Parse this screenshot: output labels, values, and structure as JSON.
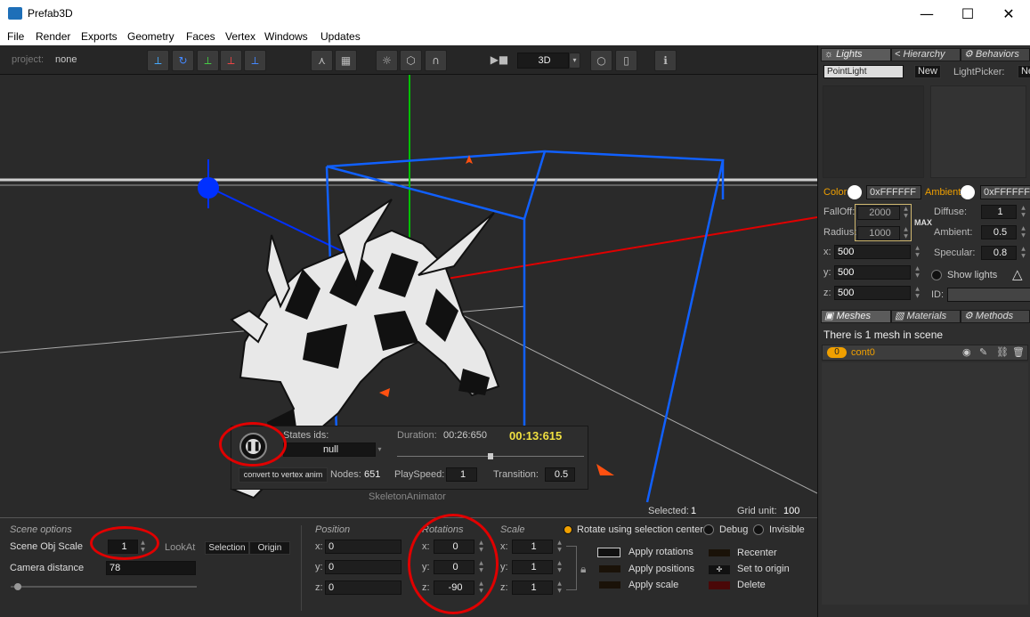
{
  "window": {
    "title": "Prefab3D",
    "minimize": "—",
    "maximize": "☐",
    "close": "✕"
  },
  "menu": [
    "File",
    "Render",
    "Exports",
    "Geometry",
    "Faces",
    "Vertex",
    "Windows",
    "Updates"
  ],
  "toolbar": {
    "project_label": "project:",
    "project_name": "none",
    "view_mode": "3D"
  },
  "viewport": {
    "selected_label": "Selected:",
    "selected_value": "1",
    "grid_label": "Grid unit:",
    "grid_value": "100"
  },
  "animator": {
    "states_label": "States ids:",
    "states_value": "null",
    "duration_label": "Duration:",
    "duration_value": "00:26:650",
    "current_time": "00:13:615",
    "convert_button": "convert to vertex anim",
    "nodes_label": "Nodes:",
    "nodes_value": "651",
    "playspeed_label": "PlaySpeed:",
    "playspeed_value": "1",
    "transition_label": "Transition:",
    "transition_value": "0.5",
    "name": "SkeletonAnimator",
    "progress": 0.5
  },
  "scene_options": {
    "title": "Scene options",
    "scale_label": "Scene Obj Scale",
    "scale_value": "1",
    "lookat_label": "LookAt",
    "selection_btn": "Selection",
    "origin_btn": "Origin",
    "camera_label": "Camera distance",
    "camera_value": "78"
  },
  "transform": {
    "position_title": "Position",
    "rotations_title": "Rotations",
    "scale_title": "Scale",
    "position": {
      "x": "0",
      "y": "0",
      "z": "0"
    },
    "rotations": {
      "x": "0",
      "y": "0",
      "z": "-90"
    },
    "scale": {
      "x": "1",
      "y": "1",
      "z": "1"
    },
    "axis_x": "x:",
    "axis_y": "y:",
    "axis_z": "z:"
  },
  "options": {
    "rotate_center": "Rotate using selection center",
    "debug": "Debug",
    "invisible": "Invisible",
    "apply_rotations": "Apply rotations",
    "apply_positions": "Apply positions",
    "apply_scale": "Apply scale",
    "recenter": "Recenter",
    "set_to_origin": "Set to origin",
    "delete": "Delete"
  },
  "lights_panel": {
    "tabs": [
      "Lights",
      "Hierarchy",
      "Behaviors"
    ],
    "light_type": "PointLight",
    "new_btn": "New",
    "lightpicker_label": "LightPicker:",
    "lightpicker_new": "New",
    "color_label": "Color",
    "color_value": "0xFFFFFF",
    "ambient_label": "Ambient",
    "ambient_value": "0xFFFFFF",
    "falloff_label": "FallOff:",
    "falloff_value": "2000",
    "radius_label": "Radius:",
    "radius_value": "1000",
    "max_label": "MAX",
    "diffuse_label": "Diffuse:",
    "diffuse_value": "1",
    "ambient2_label": "Ambient:",
    "ambient2_value": "0.5",
    "specular_label": "Specular:",
    "specular_value": "0.8",
    "x_label": "x:",
    "x_value": "500",
    "y_label": "y:",
    "y_value": "500",
    "z_label": "z:",
    "z_value": "500",
    "show_lights": "Show lights",
    "id_label": "ID:"
  },
  "meshes_panel": {
    "tabs": [
      "Meshes",
      "Materials",
      "Methods"
    ],
    "summary": "There is 1 mesh in scene",
    "mesh_index": "0",
    "mesh_name": "cont0"
  },
  "colors": {
    "accent": "#f0a000",
    "red": "#e00000",
    "x_axis": "#e00000",
    "y_axis": "#00c000",
    "z_axis": "#0030ff"
  }
}
